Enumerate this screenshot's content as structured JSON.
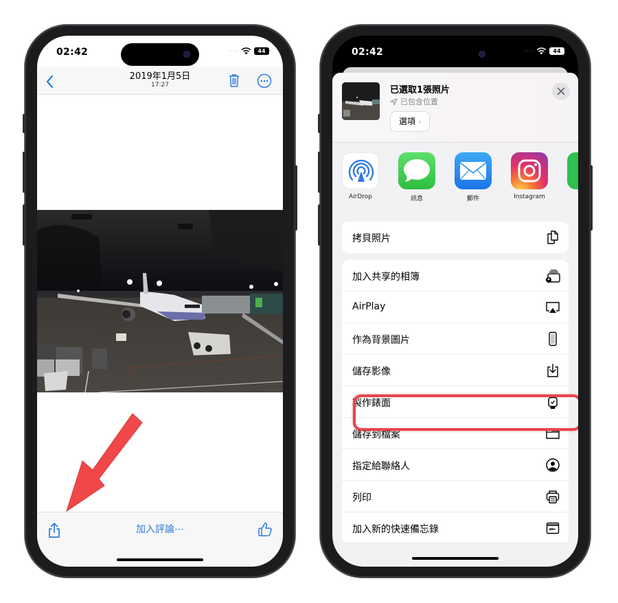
{
  "left_phone": {
    "status": {
      "time": "02:42",
      "battery": "44"
    },
    "navbar": {
      "title": "2019年1月5日",
      "subtitle": "17:27"
    },
    "bottom_bar": {
      "comment_label": "加入評論⋯"
    }
  },
  "right_phone": {
    "status": {
      "time": "02:42",
      "battery": "44"
    },
    "sheet_header": {
      "title": "已選取1張照片",
      "location_label": "已包含位置",
      "options_label": "選項",
      "options_chevron": "›"
    },
    "apps": [
      {
        "label": "AirDrop",
        "icon": "airdrop-icon"
      },
      {
        "label": "訊息",
        "icon": "messages-icon"
      },
      {
        "label": "郵件",
        "icon": "mail-icon"
      },
      {
        "label": "Instagram",
        "icon": "instagram-icon"
      }
    ],
    "actions_group_1": [
      {
        "label": "拷貝照片",
        "icon": "copy-icon"
      }
    ],
    "actions_group_2": [
      {
        "label": "加入共享的相簿",
        "icon": "shared-album-icon"
      },
      {
        "label": "AirPlay",
        "icon": "airplay-icon"
      },
      {
        "label": "作為背景圖片",
        "icon": "phone-wallpaper-icon"
      },
      {
        "label": "儲存影像",
        "icon": "save-image-icon",
        "highlighted": true
      },
      {
        "label": "製作錶面",
        "icon": "watch-face-icon"
      },
      {
        "label": "儲存到檔案",
        "icon": "folder-icon"
      },
      {
        "label": "指定給聯絡人",
        "icon": "contact-icon"
      },
      {
        "label": "列印",
        "icon": "printer-icon"
      },
      {
        "label": "加入新的快速備忘錄",
        "icon": "quick-note-icon"
      }
    ]
  },
  "annotation": {
    "highlight_color": "#e8454b",
    "arrow_color": "#f04848"
  },
  "colors": {
    "ios_blue": "#2d7ae0"
  }
}
